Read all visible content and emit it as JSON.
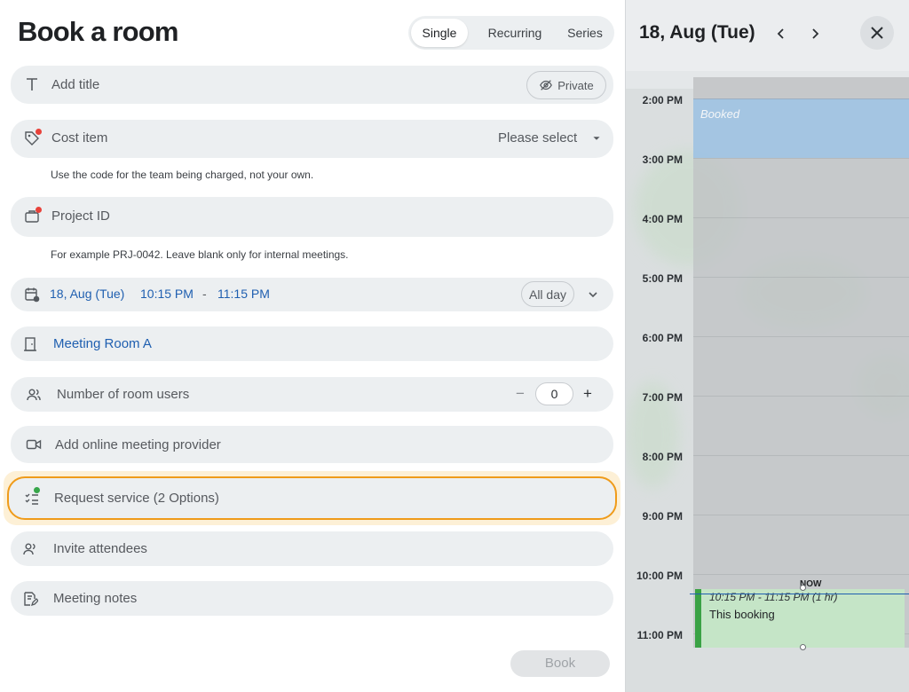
{
  "form": {
    "title": "Book a room",
    "mode_tabs": [
      "Single",
      "Recurring",
      "Series"
    ],
    "active_mode": "Single",
    "title_field": {
      "placeholder": "Add title",
      "private_label": "Private"
    },
    "cost_item": {
      "label": "Cost item",
      "value": "Please select",
      "helper": "Use the code for the team being charged, not your own."
    },
    "project_id": {
      "label": "Project ID",
      "helper": "For example PRJ-0042. Leave blank only for internal meetings."
    },
    "datetime": {
      "date": "18, Aug (Tue)",
      "start": "10:15 PM",
      "separator": "-",
      "end": "11:15 PM",
      "all_day": "All day"
    },
    "room": {
      "name": "Meeting Room A"
    },
    "room_users": {
      "label": "Number of room users",
      "value": "0",
      "minus": "−",
      "plus": "+"
    },
    "online_meeting": {
      "label": "Add online meeting provider"
    },
    "request_service": {
      "label": "Request service (2 Options)"
    },
    "attendees": {
      "label": "Invite attendees"
    },
    "notes": {
      "label": "Meeting notes"
    },
    "book_button": "Book"
  },
  "calendar": {
    "date": "18, Aug (Tue)",
    "hours": [
      "2:00 PM",
      "3:00 PM",
      "4:00 PM",
      "5:00 PM",
      "6:00 PM",
      "7:00 PM",
      "8:00 PM",
      "9:00 PM",
      "10:00 PM",
      "11:00 PM"
    ],
    "booked_label": "Booked",
    "now_label": "NOW",
    "this_booking": {
      "range": "10:15 PM - 11:15 PM (1 hr)",
      "name": "This booking"
    }
  },
  "colors": {
    "accent_blue": "#1f5fb0",
    "focus_orange": "#ef9b1a",
    "required_dot": "#e8423a",
    "service_dot": "#37a64a",
    "booking_green": "#3aa245"
  },
  "icons": {
    "title": "text-icon",
    "private": "eye-off-icon",
    "cost": "tag-icon",
    "project": "briefcase-icon",
    "date": "calendar-clock-icon",
    "room": "door-icon",
    "users": "users-icon",
    "online": "video-icon",
    "service": "checklist-icon",
    "attendees": "attendees-icon",
    "notes": "notes-icon"
  }
}
